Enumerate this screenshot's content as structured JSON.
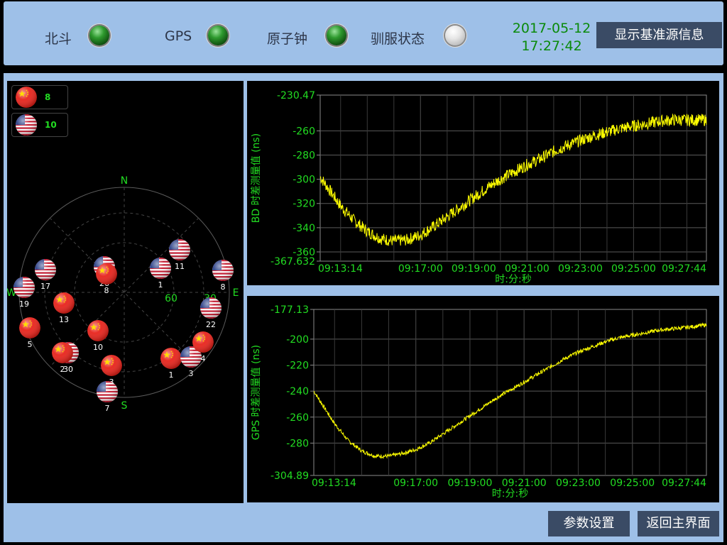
{
  "status_bar": {
    "indicators": [
      {
        "label": "北斗",
        "state": "on"
      },
      {
        "label": "GPS",
        "state": "on"
      },
      {
        "label": "原子钟",
        "state": "on"
      },
      {
        "label": "驯服状态",
        "state": "off"
      }
    ],
    "date": "2017-05-12",
    "time": "17:27:42",
    "show_ref_button": "显示基准源信息"
  },
  "sky_view": {
    "legend": [
      {
        "flag": "china-flag-icon",
        "count": "8"
      },
      {
        "flag": "usa-flag-icon",
        "count": "10"
      }
    ],
    "directions": {
      "n": "N",
      "s": "S",
      "e": "E",
      "w": "W"
    },
    "elevation_labels": [
      "60",
      "30"
    ],
    "satellites": [
      {
        "flag": "usa",
        "id": "11"
      },
      {
        "flag": "usa",
        "id": "17"
      },
      {
        "flag": "usa",
        "id": "26"
      },
      {
        "flag": "china",
        "id": "8"
      },
      {
        "flag": "usa",
        "id": "1"
      },
      {
        "flag": "usa",
        "id": "8"
      },
      {
        "flag": "usa",
        "id": "19"
      },
      {
        "flag": "china",
        "id": "13"
      },
      {
        "flag": "usa",
        "id": "22"
      },
      {
        "flag": "china",
        "id": "5"
      },
      {
        "flag": "china",
        "id": "10"
      },
      {
        "flag": "usa",
        "id": "30"
      },
      {
        "flag": "china",
        "id": "2"
      },
      {
        "flag": "china",
        "id": "3"
      },
      {
        "flag": "china",
        "id": "1"
      },
      {
        "flag": "usa",
        "id": "3"
      },
      {
        "flag": "china",
        "id": "4"
      },
      {
        "flag": "usa",
        "id": "7"
      }
    ]
  },
  "chart_data": [
    {
      "type": "line",
      "ylabel": "BD 时差测量值 (ns)",
      "xlabel": "时:分:秒",
      "ylim": [
        -367.632,
        -230.47
      ],
      "ytick_labels": [
        "-230.47",
        "-260",
        "-280",
        "-300",
        "-320",
        "-340",
        "-360",
        "-367.632"
      ],
      "xtick_labels": [
        "09:13:14",
        "09:17:00",
        "09:19:00",
        "09:21:00",
        "09:23:00",
        "09:25:00",
        "09:27:44"
      ],
      "grid": true,
      "series": [
        {
          "x": [
            "09:13:14",
            "09:14:00",
            "09:14:30",
            "09:15:00",
            "09:15:30",
            "09:16:00",
            "09:16:30",
            "09:17:00",
            "09:17:30",
            "09:18:00",
            "09:18:30",
            "09:19:00",
            "09:19:30",
            "09:20:00",
            "09:20:30",
            "09:21:00",
            "09:21:30",
            "09:22:00",
            "09:22:30",
            "09:23:00",
            "09:23:30",
            "09:24:00",
            "09:24:30",
            "09:25:00",
            "09:25:30",
            "09:26:00",
            "09:26:30",
            "09:27:00",
            "09:27:44"
          ],
          "y": [
            -298,
            -322,
            -334,
            -343,
            -349,
            -351,
            -350,
            -346,
            -339,
            -331,
            -323,
            -315,
            -307,
            -300,
            -294,
            -288,
            -283,
            -277,
            -272,
            -268,
            -264,
            -261,
            -258,
            -256,
            -254,
            -252,
            -251,
            -251,
            -251
          ],
          "color": "#ffff00"
        }
      ]
    },
    {
      "type": "line",
      "ylabel": "GPS 时差测量值 (ns)",
      "xlabel": "时:分:秒",
      "ylim": [
        -304.89,
        -177.13
      ],
      "ytick_labels": [
        "-177.13",
        "-200",
        "-220",
        "-240",
        "-260",
        "-280",
        "-304.89"
      ],
      "xtick_labels": [
        "09:13:14",
        "09:17:00",
        "09:19:00",
        "09:21:00",
        "09:23:00",
        "09:25:00",
        "09:27:44"
      ],
      "grid": true,
      "series": [
        {
          "x": [
            "09:13:14",
            "09:14:00",
            "09:14:30",
            "09:15:00",
            "09:15:30",
            "09:16:00",
            "09:16:30",
            "09:17:00",
            "09:17:30",
            "09:18:00",
            "09:18:30",
            "09:19:00",
            "09:19:30",
            "09:20:00",
            "09:20:30",
            "09:21:00",
            "09:21:30",
            "09:22:00",
            "09:22:30",
            "09:23:00",
            "09:23:30",
            "09:24:00",
            "09:24:30",
            "09:25:00",
            "09:25:30",
            "09:26:00",
            "09:26:30",
            "09:27:00",
            "09:27:44"
          ],
          "y": [
            -240,
            -265,
            -278,
            -286,
            -290,
            -290,
            -288,
            -285,
            -280,
            -273,
            -266,
            -259,
            -252,
            -245,
            -239,
            -233,
            -227,
            -221,
            -215,
            -210,
            -206,
            -202,
            -199,
            -197,
            -195,
            -193,
            -192,
            -191,
            -189
          ],
          "color": "#ffff00"
        }
      ]
    }
  ],
  "bottom_buttons": {
    "params": "参数设置",
    "back": "返回主界面"
  }
}
